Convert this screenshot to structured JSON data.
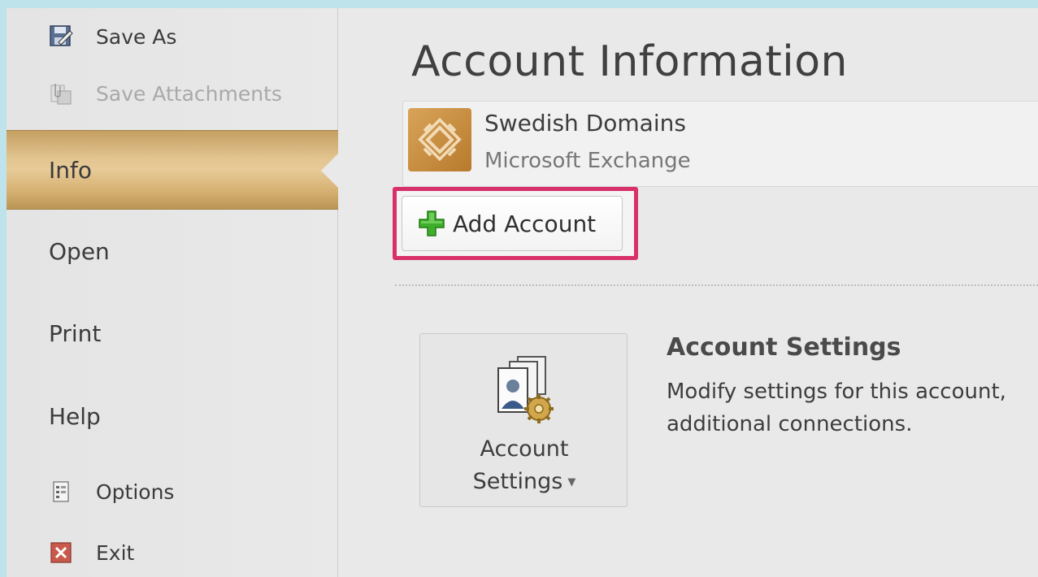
{
  "sidebar": {
    "commands_top": [
      {
        "label": "Save As",
        "icon": "save-as-icon",
        "enabled": true
      },
      {
        "label": "Save Attachments",
        "icon": "save-attachments-icon",
        "enabled": false
      }
    ],
    "tabs": [
      {
        "label": "Info",
        "selected": true
      },
      {
        "label": "Open"
      },
      {
        "label": "Print"
      },
      {
        "label": "Help"
      }
    ],
    "commands_bottom": [
      {
        "label": "Options",
        "icon": "options-icon"
      },
      {
        "label": "Exit",
        "icon": "exit-icon"
      }
    ]
  },
  "main": {
    "title": "Account Information",
    "account": {
      "name": "Swedish Domains",
      "type": "Microsoft Exchange",
      "icon": "exchange-icon"
    },
    "add_account_label": "Add Account",
    "account_settings": {
      "button_label_line1": "Account",
      "button_label_line2": "Settings",
      "heading": "Account Settings",
      "desc_line1": "Modify settings for this account,",
      "desc_line2": "additional connections."
    }
  },
  "colors": {
    "highlight": "#d8306a",
    "selected_tab": "#e2c48f",
    "plus_green": "#3fae2a"
  }
}
